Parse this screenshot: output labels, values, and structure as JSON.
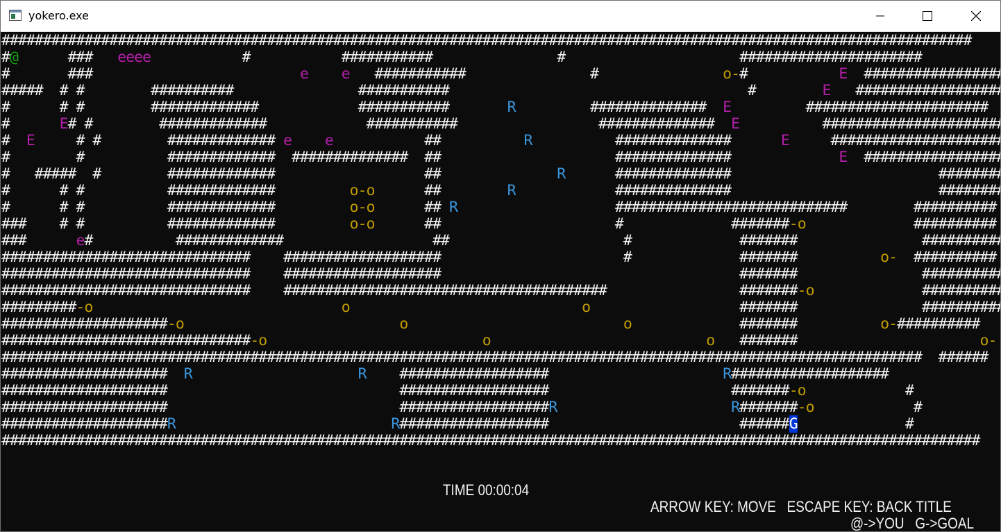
{
  "window": {
    "title": "yokero.exe"
  },
  "game": {
    "map_rows": [
      "#####################################################################################################################",
      "#@      ###   eeee           #           ###########               #                     ######################",
      "#       ###                         e    e   ###########               #               o-#           E  #####################",
      "#####  # #        ##########               ###########                                    #        E   ######################",
      "#      # #        #############            ###########       R         ##############  E         ######################",
      "#      E# #        #############            ###########                 ##############  E          ######################",
      "#  E     # #        ############# e    e           ##          R          ##############      E     ######################",
      "#        #          #############  ##############  ##                     ##############             E  #####################",
      "#   #####  #        #############                  ##              R      ##############                         ##########",
      "#      # #          #############         o-o      ##        R            ##############                         ##########",
      "#      # #          #############         o-o      ## R                   ############################        ##########",
      "###    # #          #############         o-o      ##                     #             #######-o             ##########",
      "###      e#          #############                  ##                     #             #######               ##########",
      "##############################    ###################                      #             #######          o-  ##########",
      "##############################    ###################                                    #######               ##########",
      "##############################    #######################################                #######-o             ##########",
      "#########-o                              o                            o                  #######               ##########",
      "####################-o                          o                          o             #######          o-##########",
      "##############################-o                          o                          o   #######                      o-",
      "###############################################################################################################  ######  #",
      "####################  R                    R    ##################                     R################### ",
      "####################                            ##################                      #######-o            #",
      "####################                            ##################R                     R#######-o            #",
      "####################R                          R##################                       ######G             #",
      "######################################################################################################################"
    ],
    "tokens": [
      {
        "ch": "@",
        "kind": "player"
      },
      {
        "ch": "e",
        "kind": "enemy-small"
      },
      {
        "ch": "E",
        "kind": "enemy-large"
      },
      {
        "ch": "R",
        "kind": "enemy-runner"
      },
      {
        "ch": "o-o",
        "kind": "coin-chain"
      },
      {
        "ch": "G",
        "kind": "goal"
      }
    ],
    "time_label": "TIME 00:00:04",
    "controls_label": "ARROW KEY: MOVE   ESCAPE KEY: BACK TITLE",
    "legend_label": "@->YOU   G->GOAL"
  },
  "colors": {
    "background": "#0c0c0c",
    "wall": "#f2f2f2",
    "player": "#13a10e",
    "enemy": "#b31fa8",
    "runner": "#3a96dd",
    "coin": "#c19c00",
    "goal_bg": "#0037da"
  }
}
